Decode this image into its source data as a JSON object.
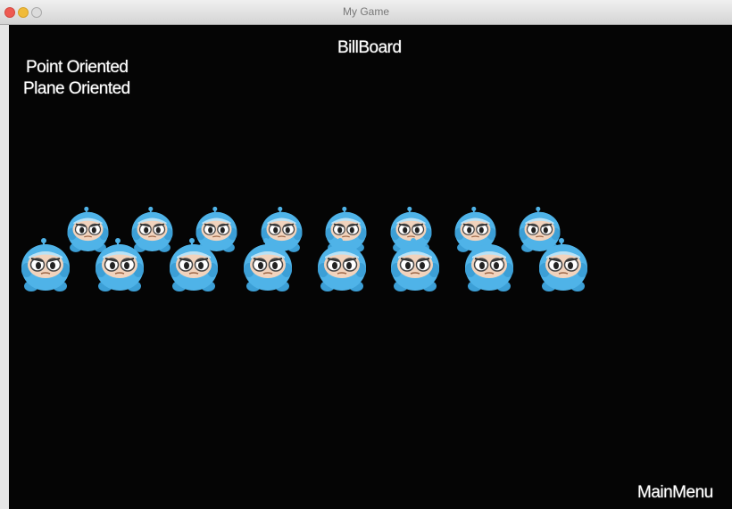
{
  "window": {
    "title": "My Game",
    "controls": [
      "close",
      "minimize",
      "maximize"
    ]
  },
  "scene": {
    "title": "BillBoard",
    "menu": [
      "Point Oriented",
      "Plane Oriented"
    ],
    "back_label": "MainMenu",
    "background": "#050505"
  },
  "sprites": {
    "character": "blue-hooded-robot",
    "back_row_count": 8,
    "front_row_count": 8,
    "body_color": "#4fb3e8",
    "face_color": "#f1d3bd"
  }
}
